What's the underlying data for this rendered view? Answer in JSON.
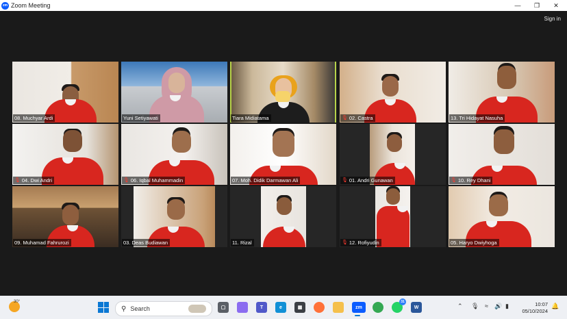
{
  "window": {
    "title": "Zoom Meeting",
    "logo_text": "zm"
  },
  "header": {
    "signin_label": "Sign in"
  },
  "participants": [
    {
      "name": "08. Muchyar Ardi",
      "muted": false
    },
    {
      "name": "Yuni Setiyawati",
      "muted": false
    },
    {
      "name": "Tiara Midiatama",
      "muted": false,
      "active_speaker": true
    },
    {
      "name": "02. Castra",
      "muted": true
    },
    {
      "name": "13. Tri Hidayat Nasuha",
      "muted": false
    },
    {
      "name": "04. Dwi Andri",
      "muted": true
    },
    {
      "name": "06. Iqbal Muhammadin",
      "muted": true
    },
    {
      "name": "07. Moh. Didik Darmawan Ali",
      "muted": false
    },
    {
      "name": "01. Andri Gunawan",
      "muted": true
    },
    {
      "name": "10. Rey Dhani",
      "muted": true
    },
    {
      "name": "09. Muhamad Fahrurozi",
      "muted": false
    },
    {
      "name": "03. Deas Budiawan",
      "muted": false
    },
    {
      "name": "11. Rizal",
      "muted": false
    },
    {
      "name": "12. Rofiyudin",
      "muted": true
    },
    {
      "name": "05. Haryo Dwiyhoga",
      "muted": false
    }
  ],
  "taskbar": {
    "weather_temp": "30°",
    "search_placeholder": "Search",
    "apps": [
      "task-view",
      "copilot",
      "teams",
      "edge",
      "store",
      "firefox",
      "file-explorer",
      "zoom",
      "chrome",
      "whatsapp",
      "word"
    ],
    "active_app": "zoom",
    "whatsapp_badge": "31",
    "time": "10:07",
    "date": "05/10/2024"
  },
  "colors": {
    "accent": "#0b5cff",
    "active_speaker": "#b8d34a",
    "uniform": "#d8261f"
  }
}
